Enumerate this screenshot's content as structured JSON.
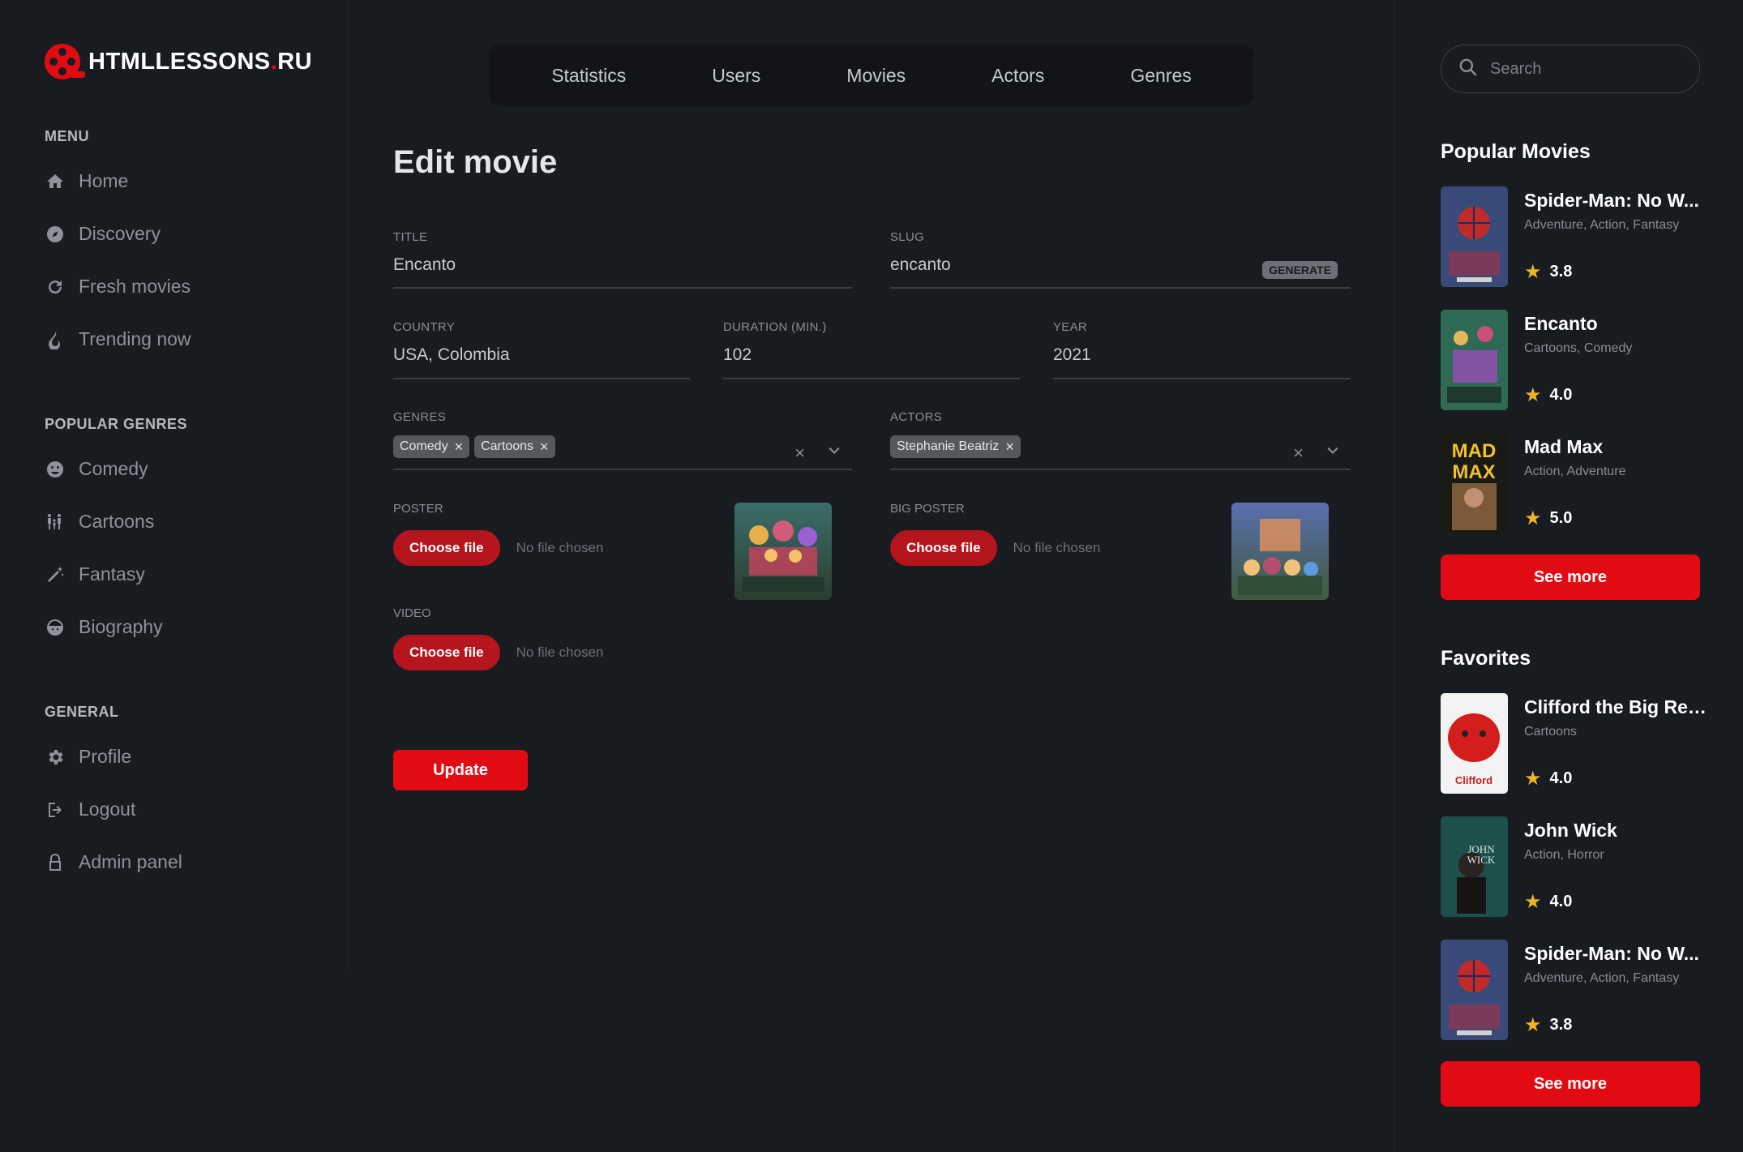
{
  "brand": {
    "logo_main": "HTMLLESSONS",
    "logo_dot": ".",
    "logo_tld": "RU"
  },
  "sidebar": {
    "menu_title": "MENU",
    "menu": [
      {
        "label": "Home",
        "icon": "home-icon"
      },
      {
        "label": "Discovery",
        "icon": "compass-icon"
      },
      {
        "label": "Fresh movies",
        "icon": "refresh-icon"
      },
      {
        "label": "Trending now",
        "icon": "fire-icon"
      }
    ],
    "genres_title": "POPULAR GENRES",
    "genres": [
      {
        "label": "Comedy",
        "icon": "smile-icon"
      },
      {
        "label": "Cartoons",
        "icon": "family-icon"
      },
      {
        "label": "Fantasy",
        "icon": "magic-wand-icon"
      },
      {
        "label": "Biography",
        "icon": "face-icon"
      }
    ],
    "general_title": "GENERAL",
    "general": [
      {
        "label": "Profile",
        "icon": "gear-icon"
      },
      {
        "label": "Logout",
        "icon": "logout-icon"
      },
      {
        "label": "Admin panel",
        "icon": "lock-icon"
      }
    ]
  },
  "tabs": [
    "Statistics",
    "Users",
    "Movies",
    "Actors",
    "Genres"
  ],
  "form": {
    "title": "Edit movie",
    "title_label": "TITLE",
    "title_value": "Encanto",
    "slug_label": "SLUG",
    "slug_value": "encanto",
    "generate_label": "GENERATE",
    "country_label": "COUNTRY",
    "country_value": "USA, Colombia",
    "duration_label": "DURATION (MIN.)",
    "duration_value": "102",
    "year_label": "YEAR",
    "year_value": "2021",
    "genres_label": "GENRES",
    "genres_chips": [
      "Comedy",
      "Cartoons"
    ],
    "actors_label": "ACTORS",
    "actors_chips": [
      "Stephanie Beatriz"
    ],
    "poster_label": "POSTER",
    "big_poster_label": "BIG POSTER",
    "video_label": "VIDEO",
    "choose_file": "Choose file",
    "no_file": "No file chosen",
    "update_label": "Update"
  },
  "search": {
    "placeholder": "Search"
  },
  "popular": {
    "title": "Popular Movies",
    "items": [
      {
        "name": "Spider-Man: No W...",
        "genres": "Adventure, Action, Fantasy",
        "rating": "3.8"
      },
      {
        "name": "Encanto",
        "genres": "Cartoons, Comedy",
        "rating": "4.0"
      },
      {
        "name": "Mad Max",
        "genres": "Action, Adventure",
        "rating": "5.0"
      }
    ],
    "see_more": "See more"
  },
  "favorites": {
    "title": "Favorites",
    "items": [
      {
        "name": "Clifford the Big Red...",
        "genres": "Cartoons",
        "rating": "4.0"
      },
      {
        "name": "John Wick",
        "genres": "Action, Horror",
        "rating": "4.0"
      },
      {
        "name": "Spider-Man: No W...",
        "genres": "Adventure, Action, Fantasy",
        "rating": "3.8"
      }
    ],
    "see_more": "See more"
  },
  "poster_art": {
    "mad_max_line1": "MAD",
    "mad_max_line2": "MAX",
    "clifford": "Clifford",
    "john_wick_line1": "JOHN",
    "john_wick_line2": "WICK"
  },
  "colors": {
    "accent": "#e30b13",
    "background": "#181b1f",
    "star": "#f0b429"
  }
}
